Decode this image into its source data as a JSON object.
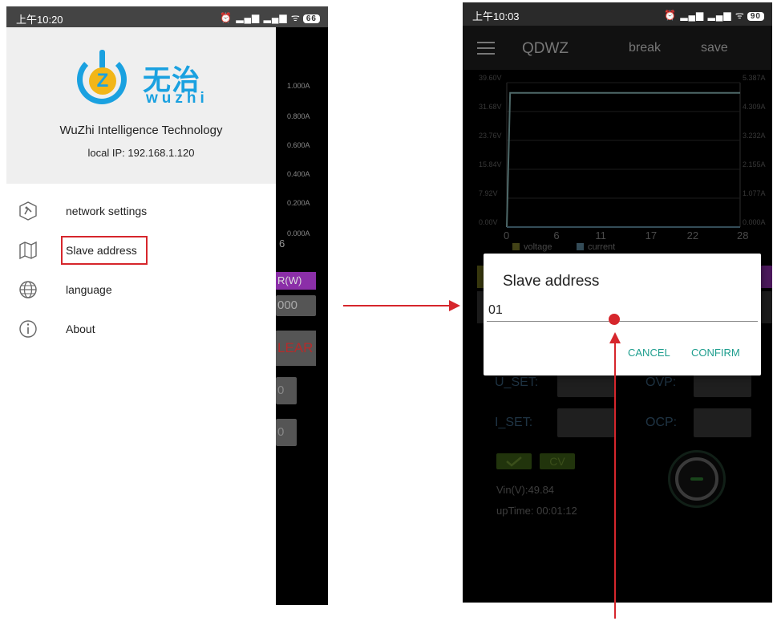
{
  "left_phone": {
    "status_time": "上午10:20",
    "battery": "66",
    "drawer": {
      "logo_cn": "无治",
      "logo_en": "wuzhi",
      "company": "WuZhi Intelligence Technology",
      "local_ip": "local IP: 192.168.1.120",
      "items": [
        {
          "label": "network settings",
          "icon": "network-settings-icon"
        },
        {
          "label": "Slave address",
          "icon": "map-icon"
        },
        {
          "label": "language",
          "icon": "globe-icon"
        },
        {
          "label": "About",
          "icon": "info-icon"
        }
      ]
    },
    "background": {
      "current_ticks": [
        "1.000A",
        "0.800A",
        "0.600A",
        "0.400A",
        "0.200A",
        "0.000A"
      ],
      "x_tick_partial": "6",
      "power_label": "R(W)",
      "power_value": "000",
      "clear_label": "LEAR",
      "box1": "0",
      "box2": "0"
    }
  },
  "right_phone": {
    "status_time": "上午10:03",
    "battery": "90",
    "app_title": "QDWZ",
    "break_label": "break",
    "save_label": "save",
    "chart_data": {
      "type": "line",
      "x": [
        0,
        0.4,
        28
      ],
      "series": [
        {
          "name": "voltage",
          "values": [
            0,
            36.8,
            36.8
          ],
          "color": "#7a7a2a"
        },
        {
          "name": "current",
          "values": [
            0,
            0,
            0
          ],
          "color": "#5f8aa0"
        }
      ],
      "x_ticks": [
        "0",
        "6",
        "11",
        "17",
        "22",
        "28"
      ],
      "y_left_ticks": [
        "0.00V",
        "7.92V",
        "15.84V",
        "23.76V",
        "31.68V",
        "39.60V"
      ],
      "y_right_ticks": [
        "0.000A",
        "1.077A",
        "2.155A",
        "3.232A",
        "4.309A",
        "5.387A"
      ],
      "ylim_left": [
        0,
        39.6
      ],
      "ylim_right": [
        0,
        5.387
      ],
      "xlim": [
        0,
        28
      ],
      "legend": "bottom-left"
    },
    "panel": {
      "u_set_label": "U_SET:",
      "i_set_label": "I_SET:",
      "ovp_label": "OVP:",
      "ocp_label": "OCP:",
      "cv_label": "CV",
      "vin": "Vin(V):49.84",
      "uptime": "upTime:  00:01:12"
    },
    "dialog": {
      "title": "Slave address",
      "value": "01",
      "cancel": "CANCEL",
      "confirm": "CONFIRM"
    }
  }
}
